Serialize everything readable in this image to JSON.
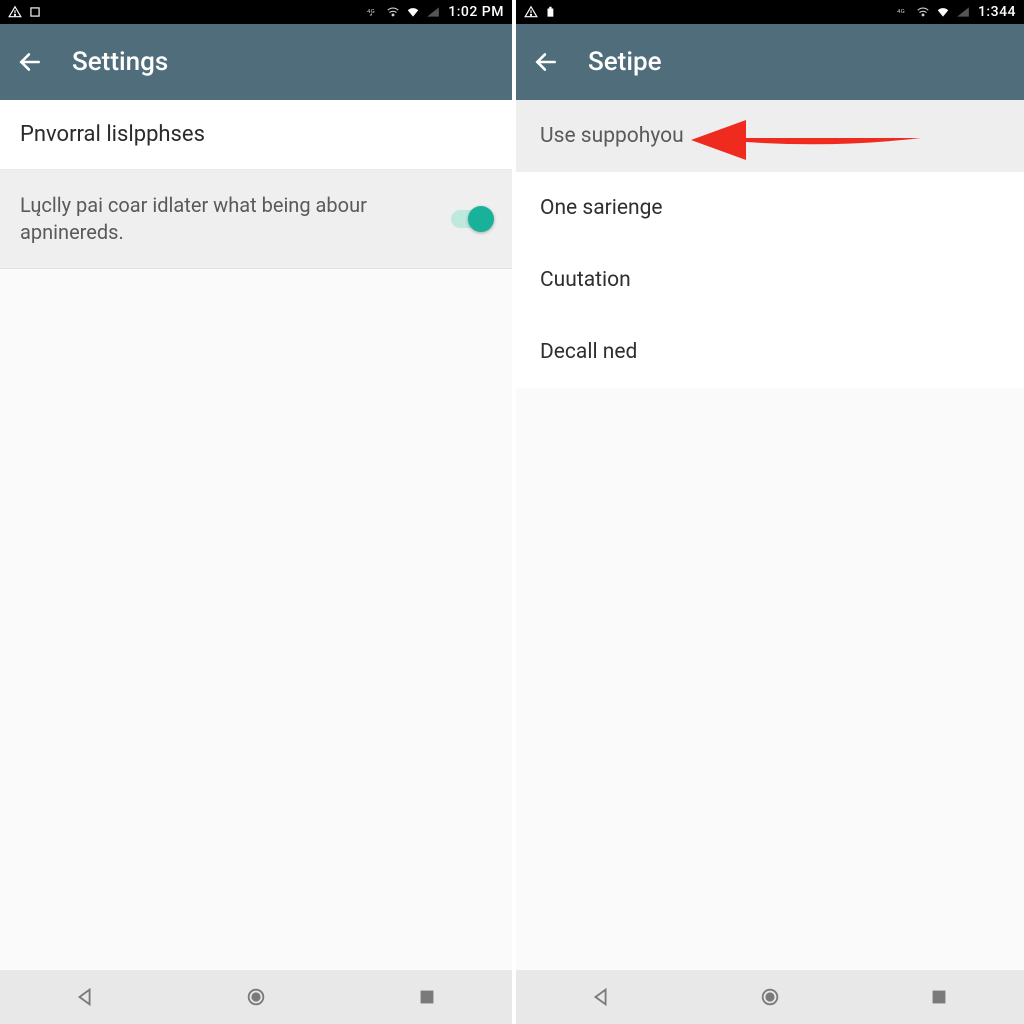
{
  "left": {
    "status": {
      "time": "1:02 PM"
    },
    "title": "Settings",
    "section_header": "Pnvorral lislpphses",
    "toggle": {
      "description": "Lųclly pai coar idlater what being abour apninereds.",
      "on": true
    }
  },
  "right": {
    "status": {
      "time": "1:344"
    },
    "title": "Setipe",
    "items": [
      {
        "label": "Use suppohyou",
        "highlight": true
      },
      {
        "label": "One sarienge",
        "highlight": false
      },
      {
        "label": "Cuutation",
        "highlight": false
      },
      {
        "label": "Decall ned",
        "highlight": false
      }
    ]
  },
  "colors": {
    "action_bar": "#4f6d7a",
    "switch_accent": "#18b29a",
    "arrow": "#ef2a1f"
  },
  "nav_buttons": [
    "back",
    "home",
    "recent"
  ]
}
